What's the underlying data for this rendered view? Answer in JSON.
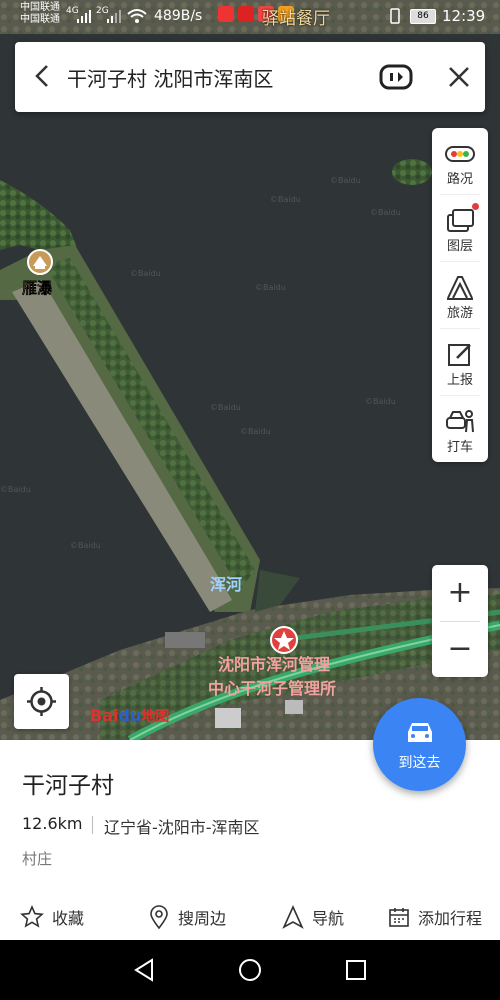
{
  "status_bar": {
    "carrier_1": "中国联通",
    "carrier_2": "中国联通",
    "sig_1": "4G",
    "sig_2": "2G",
    "net_speed": "489B/s",
    "notification_title": "驿站餐厅",
    "battery": "86",
    "time": "12:39"
  },
  "search": {
    "query": "干河子村 沈阳市浑南区"
  },
  "tools": [
    {
      "label": "路况",
      "icon": "traffic-icon"
    },
    {
      "label": "图层",
      "icon": "layers-icon"
    },
    {
      "label": "旅游",
      "icon": "travel-icon"
    },
    {
      "label": "上报",
      "icon": "report-icon"
    },
    {
      "label": "打车",
      "icon": "taxi-icon"
    }
  ],
  "map": {
    "poi_yanpu": "雁瀑",
    "river_label": "浑河",
    "poi_main_line1": "沈阳市浑河管理",
    "poi_main_line2": "中心干河子管理所",
    "watermark": "©Baidu"
  },
  "zoom": {
    "plus": "+",
    "minus": "−"
  },
  "logo": {
    "bai": "Bai",
    "paw": "du",
    "ditu": "地图"
  },
  "go_here": {
    "label": "到这去"
  },
  "place": {
    "name": "干河子村",
    "distance": "12.6km",
    "region": "辽宁省-沈阳市-浑南区",
    "type": "村庄"
  },
  "actions": [
    {
      "label": "收藏",
      "icon": "star-icon"
    },
    {
      "label": "搜周边",
      "icon": "location-pin-icon"
    },
    {
      "label": "导航",
      "icon": "navigation-icon"
    },
    {
      "label": "添加行程",
      "icon": "calendar-icon"
    }
  ],
  "colors": {
    "accent": "#3a85f3",
    "water": "#2f3335",
    "road": "#3aa86b",
    "poi_text": "#f08080"
  }
}
